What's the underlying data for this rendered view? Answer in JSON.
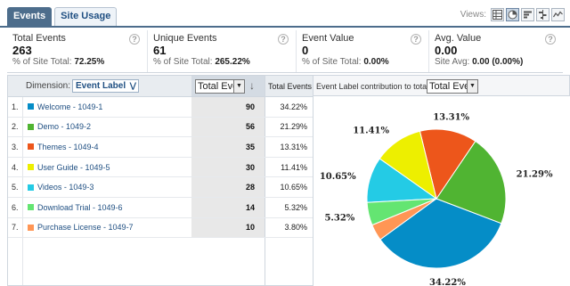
{
  "tabs": [
    {
      "label": "Events",
      "active": true
    },
    {
      "label": "Site Usage",
      "active": false
    }
  ],
  "views_label": "Views:",
  "view_icons": [
    "table-view-icon",
    "pie-view-icon",
    "performance-view-icon",
    "comparison-view-icon",
    "pivot-view-icon"
  ],
  "metrics": [
    {
      "label": "Total Events",
      "value": "263",
      "sub_prefix": "% of Site Total:",
      "sub_value": "72.25%"
    },
    {
      "label": "Unique Events",
      "value": "61",
      "sub_prefix": "% of Site Total:",
      "sub_value": "265.22%"
    },
    {
      "label": "Event Value",
      "value": "0",
      "sub_prefix": "% of Site Total:",
      "sub_value": "0.00%"
    },
    {
      "label": "Avg. Value",
      "value": "0.00",
      "sub_prefix": "Site Avg:",
      "sub_value": "0.00 (0.00%)"
    }
  ],
  "table": {
    "dimension_label": "Dimension:",
    "dimension_value": "Event Label",
    "sort_select": "Total Events",
    "column_header": "Total Events",
    "rows": [
      {
        "num": "1.",
        "label": "Welcome - 1049-1",
        "value": "90",
        "pct": "34.22%",
        "color": "#058dc7"
      },
      {
        "num": "2.",
        "label": "Demo - 1049-2",
        "value": "56",
        "pct": "21.29%",
        "color": "#50b432"
      },
      {
        "num": "3.",
        "label": "Themes - 1049-4",
        "value": "35",
        "pct": "13.31%",
        "color": "#ed561b"
      },
      {
        "num": "4.",
        "label": "User Guide - 1049-5",
        "value": "30",
        "pct": "11.41%",
        "color": "#edef00"
      },
      {
        "num": "5.",
        "label": "Videos - 1049-3",
        "value": "28",
        "pct": "10.65%",
        "color": "#24cbe5"
      },
      {
        "num": "6.",
        "label": "Download Trial - 1049-6",
        "value": "14",
        "pct": "5.32%",
        "color": "#64e572"
      },
      {
        "num": "7.",
        "label": "Purchase License - 1049-7",
        "value": "10",
        "pct": "3.80%",
        "color": "#ff9655"
      }
    ]
  },
  "pie": {
    "header_label": "Event Label contribution to total:",
    "select_value": "Total Events"
  },
  "chart_data": {
    "type": "pie",
    "categories": [
      "Welcome - 1049-1",
      "Demo - 1049-2",
      "Themes - 1049-4",
      "User Guide - 1049-5",
      "Videos - 1049-3",
      "Download Trial - 1049-6",
      "Purchase License - 1049-7"
    ],
    "values": [
      90,
      56,
      35,
      30,
      28,
      14,
      10
    ],
    "labels": [
      "34.22%",
      "21.29%",
      "13.31%",
      "11.41%",
      "10.65%",
      "5.32%",
      ""
    ],
    "colors": [
      "#058dc7",
      "#50b432",
      "#ed561b",
      "#edef00",
      "#24cbe5",
      "#64e572",
      "#ff9655"
    ],
    "title": "",
    "legend": "none"
  }
}
